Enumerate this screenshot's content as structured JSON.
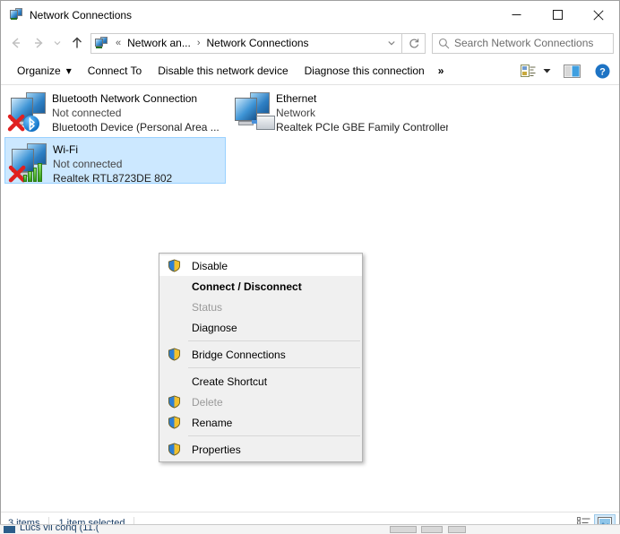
{
  "window": {
    "title": "Network Connections",
    "title_icon": "network-connections-icon",
    "controls": {
      "minimize": "minimize-icon",
      "maximize": "maximize-icon",
      "close": "close-icon"
    }
  },
  "navbar": {
    "back": "back-arrow-icon",
    "forward": "forward-arrow-icon",
    "recent": "recent-locations-chevron-icon",
    "up": "up-arrow-icon",
    "breadcrumb_icon": "network-connections-icon",
    "breadcrumb": [
      "Network an...",
      "Network Connections"
    ],
    "breadcrumb_prefix": "«",
    "breadcrumb_separator": "›",
    "dropdown": "chevron-down-icon",
    "refresh": "refresh-icon"
  },
  "search": {
    "icon": "search-icon",
    "placeholder": "Search Network Connections",
    "value": ""
  },
  "toolbar": {
    "organize": "Organize",
    "organize_caret": "▾",
    "connect_to": "Connect To",
    "disable_device": "Disable this network device",
    "diagnose_connection": "Diagnose this connection",
    "overflow": "»",
    "view_options_icon": "change-view-icon",
    "view_caret": "▾",
    "preview_pane_icon": "preview-pane-icon",
    "help_icon": "help-icon"
  },
  "connections": [
    {
      "name": "Bluetooth Network Connection",
      "status": "Not connected",
      "device": "Bluetooth Device (Personal Area ...",
      "icon": "bluetooth-network-adapter-icon",
      "selected": false
    },
    {
      "name": "Ethernet",
      "status": "Network",
      "device": "Realtek PCIe GBE Family Controller",
      "icon": "ethernet-adapter-icon",
      "selected": false
    },
    {
      "name": "Wi-Fi",
      "status": "Not connected",
      "device": "Realtek RTL8723DE 802",
      "icon": "wifi-adapter-icon",
      "selected": true
    }
  ],
  "context_menu": {
    "items": [
      {
        "label": "Disable",
        "shield": true,
        "disabled": false,
        "bold": false,
        "hover": true
      },
      {
        "label": "Connect / Disconnect",
        "shield": false,
        "disabled": false,
        "bold": true,
        "hover": false
      },
      {
        "label": "Status",
        "shield": false,
        "disabled": true,
        "bold": false,
        "hover": false
      },
      {
        "label": "Diagnose",
        "shield": false,
        "disabled": false,
        "bold": false,
        "hover": false
      },
      {
        "separator": true
      },
      {
        "label": "Bridge Connections",
        "shield": true,
        "disabled": false,
        "bold": false,
        "hover": false
      },
      {
        "separator": true
      },
      {
        "label": "Create Shortcut",
        "shield": false,
        "disabled": false,
        "bold": false,
        "hover": false
      },
      {
        "label": "Delete",
        "shield": true,
        "disabled": true,
        "bold": false,
        "hover": false
      },
      {
        "label": "Rename",
        "shield": true,
        "disabled": false,
        "bold": false,
        "hover": false
      },
      {
        "separator": true
      },
      {
        "label": "Properties",
        "shield": true,
        "disabled": false,
        "bold": false,
        "hover": false
      }
    ],
    "shield_icon": "uac-shield-icon"
  },
  "statusbar": {
    "item_count": "3 items",
    "selection": "1 item selected",
    "details_view_icon": "details-view-icon",
    "large_icons_view_icon": "large-icons-view-icon"
  },
  "background_strip": {
    "text": "Lucs vll conq (11.(",
    "icon": "taskbar-window-icon"
  },
  "colors": {
    "selection_fill": "#cce8ff",
    "selection_border": "#99d1ff",
    "menu_background": "#f0f0f0",
    "menu_border": "#b4b4b4",
    "status_text": "#1c3f66",
    "help_blue": "#1d73c4"
  }
}
